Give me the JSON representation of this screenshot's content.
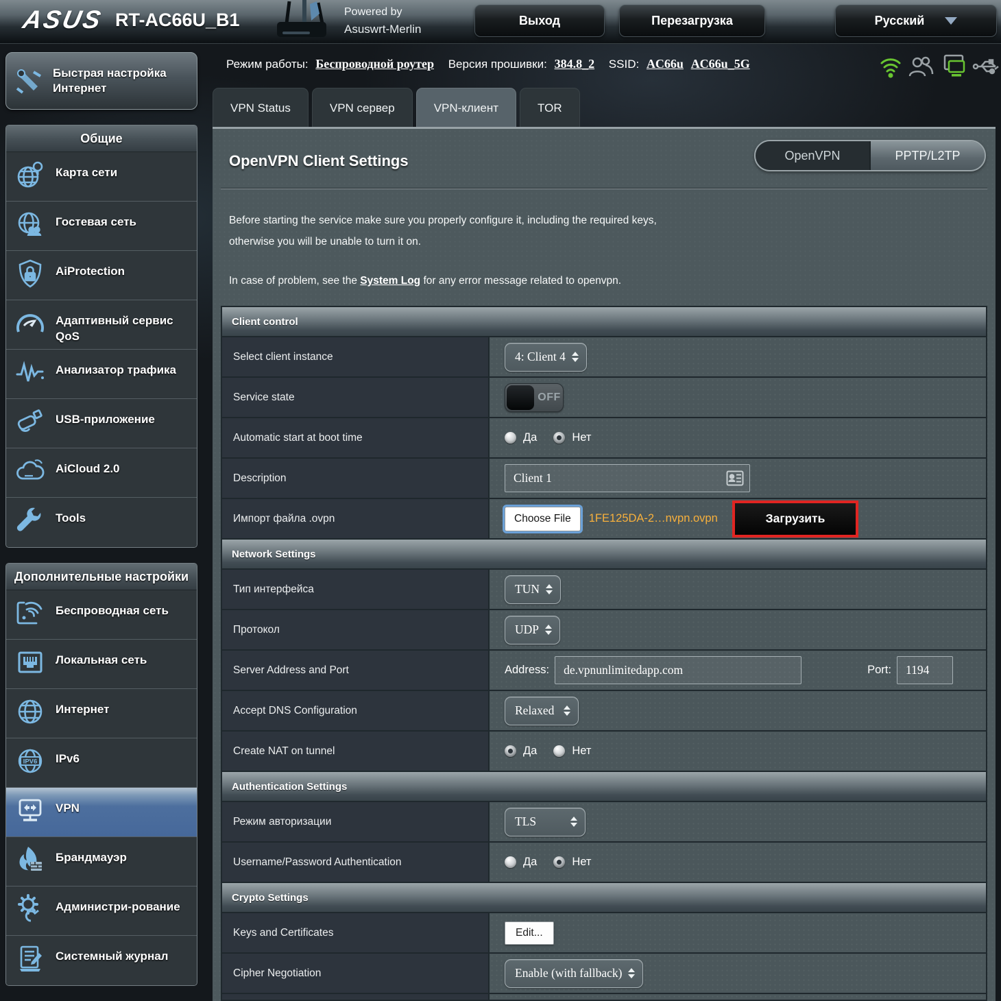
{
  "colors": {
    "highlight_red": "#e02522",
    "file_name_orange": "#f7b03c",
    "selected_item_blue": "#46689a",
    "sidebar_icon_blue": "#7cb8e2",
    "status_icon_green": "#69c531"
  },
  "header": {
    "brand": "ASUS",
    "model": "RT-AC66U_B1",
    "powered_by_line1": "Powered by",
    "powered_by_line2": "Asuswrt-Merlin",
    "logout_label": "Выход",
    "reboot_label": "Перезагрузка",
    "language": "Русский"
  },
  "statusbar": {
    "mode_label": "Режим работы:",
    "mode_value": "Беспроводной роутер",
    "firmware_label": "Версия прошивки:",
    "firmware_value": "384.8_2",
    "ssid_label": "SSID:",
    "ssid_1": "AC66u",
    "ssid_2": "AC66u_5G"
  },
  "sidebar": {
    "quick_setup": "Быстрая настройка Интернет",
    "general_header": "Общие",
    "general_items": [
      {
        "label": "Карта сети",
        "icon": "network-map-icon"
      },
      {
        "label": "Гостевая сеть",
        "icon": "guest-network-icon"
      },
      {
        "label": "AiProtection",
        "icon": "shield-lock-icon"
      },
      {
        "label": "Адаптивный сервис QoS",
        "icon": "gauge-icon"
      },
      {
        "label": "Анализатор трафика",
        "icon": "traffic-wave-icon"
      },
      {
        "label": "USB-приложение",
        "icon": "usb-drive-icon"
      },
      {
        "label": "AiCloud 2.0",
        "icon": "cloud-icon"
      },
      {
        "label": "Tools",
        "icon": "wrench-icon"
      }
    ],
    "advanced_header": "Дополнительные настройки",
    "advanced_items": [
      {
        "label": "Беспроводная сеть",
        "icon": "wireless-icon"
      },
      {
        "label": "Локальная сеть",
        "icon": "lan-port-icon"
      },
      {
        "label": "Интернет",
        "icon": "globe-icon"
      },
      {
        "label": "IPv6",
        "icon": "ipv6-globe-icon"
      },
      {
        "label": "VPN",
        "icon": "vpn-monitor-icon"
      },
      {
        "label": "Брандмауэр",
        "icon": "firewall-flame-icon"
      },
      {
        "label": "Администри-рование",
        "icon": "admin-gear-icon"
      },
      {
        "label": "Системный журнал",
        "icon": "system-log-icon"
      }
    ]
  },
  "tabs": [
    {
      "label": "VPN Status"
    },
    {
      "label": "VPN сервер"
    },
    {
      "label": "VPN-клиент"
    },
    {
      "label": "TOR"
    }
  ],
  "main": {
    "title": "OpenVPN Client Settings",
    "vpn_type": {
      "openvpn": "OpenVPN",
      "pptp": "PPTP/L2TP"
    },
    "intro_line1": "Before starting the service make sure you properly configure it, including the required keys,",
    "intro_line2": "otherwise you will be unable to turn it on.",
    "problem_pre": "In case of problem, see the ",
    "problem_link": "System Log",
    "problem_post": " for any error message related to openvpn.",
    "yes_label": "Да",
    "no_label": "Нет",
    "client_control": {
      "header": "Client control",
      "instance_label": "Select client instance",
      "instance_value": "4: Client 4",
      "service_state_label": "Service state",
      "service_state_value": "OFF",
      "auto_start_label": "Automatic start at boot time",
      "description_label": "Description",
      "description_value": "Client 1",
      "import_label": "Импорт файла .ovpn",
      "choose_file_label": "Choose File",
      "file_name": "1FE125DA-2…nvpn.ovpn",
      "upload_label": "Загрузить"
    },
    "network": {
      "header": "Network Settings",
      "iface_label": "Тип интерфейса",
      "iface_value": "TUN",
      "proto_label": "Протокол",
      "proto_value": "UDP",
      "server_label": "Server Address and Port",
      "address_label": "Address:",
      "address_value": "de.vpnunlimitedapp.com",
      "port_label": "Port:",
      "port_value": "1194",
      "dns_label": "Accept DNS Configuration",
      "dns_value": "Relaxed",
      "nat_label": "Create NAT on tunnel"
    },
    "auth": {
      "header": "Authentication Settings",
      "mode_label": "Режим авторизации",
      "mode_value": "TLS",
      "userpass_label": "Username/Password Authentication"
    },
    "crypto": {
      "header": "Crypto Settings",
      "keys_label": "Keys and Certificates",
      "edit_label": "Edit...",
      "cipher_label": "Cipher Negotiation",
      "cipher_value": "Enable (with fallback)"
    }
  }
}
